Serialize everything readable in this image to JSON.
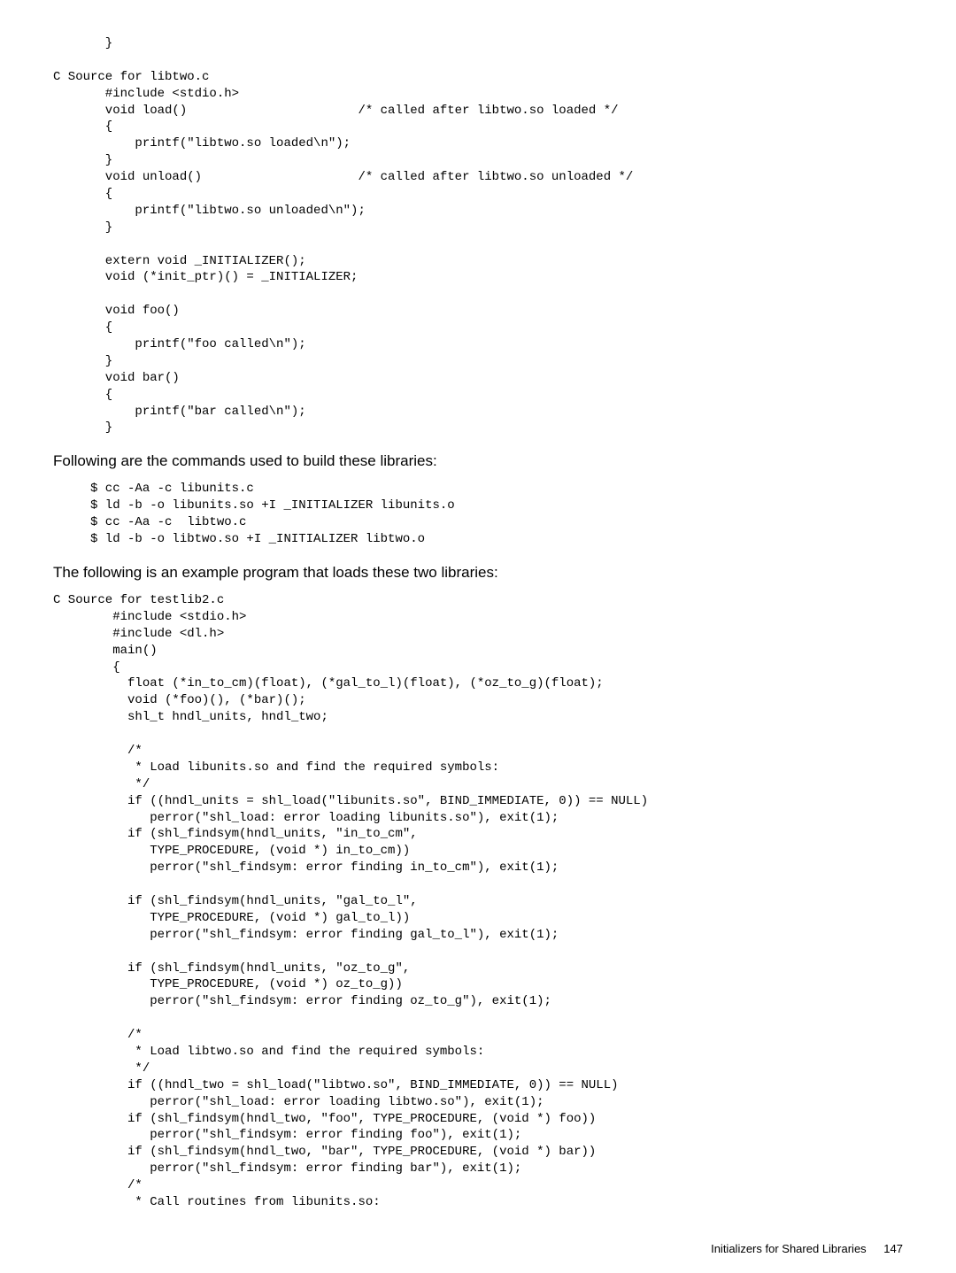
{
  "block1": "       }\n\nC Source for libtwo.c\n       #include <stdio.h>\n       void load()                       /* called after libtwo.so loaded */\n       {\n           printf(\"libtwo.so loaded\\n\");\n       }\n       void unload()                     /* called after libtwo.so unloaded */\n       {\n           printf(\"libtwo.so unloaded\\n\");\n       }\n\n       extern void _INITIALIZER();\n       void (*init_ptr)() = _INITIALIZER;\n\n       void foo()\n       {\n           printf(\"foo called\\n\");\n       }\n       void bar()\n       {\n           printf(\"bar called\\n\");\n       }",
  "narr1": "Following are the commands used to build these libraries:",
  "block2": "     $ cc -Aa -c libunits.c\n     $ ld -b -o libunits.so +I _INITIALIZER libunits.o\n     $ cc -Aa -c  libtwo.c\n     $ ld -b -o libtwo.so +I _INITIALIZER libtwo.o",
  "narr2": "The following is an example program that loads these two libraries:",
  "block3": "C Source for testlib2.c\n        #include <stdio.h>\n        #include <dl.h>\n        main()\n        {\n          float (*in_to_cm)(float), (*gal_to_l)(float), (*oz_to_g)(float);\n          void (*foo)(), (*bar)();\n          shl_t hndl_units, hndl_two;\n\n          /*\n           * Load libunits.so and find the required symbols:\n           */\n          if ((hndl_units = shl_load(\"libunits.so\", BIND_IMMEDIATE, 0)) == NULL)\n             perror(\"shl_load: error loading libunits.so\"), exit(1);\n          if (shl_findsym(hndl_units, \"in_to_cm\",\n             TYPE_PROCEDURE, (void *) in_to_cm))\n             perror(\"shl_findsym: error finding in_to_cm\"), exit(1);\n\n          if (shl_findsym(hndl_units, \"gal_to_l\",\n             TYPE_PROCEDURE, (void *) gal_to_l))\n             perror(\"shl_findsym: error finding gal_to_l\"), exit(1);\n\n          if (shl_findsym(hndl_units, \"oz_to_g\",\n             TYPE_PROCEDURE, (void *) oz_to_g))\n             perror(\"shl_findsym: error finding oz_to_g\"), exit(1);\n\n          /*\n           * Load libtwo.so and find the required symbols:\n           */\n          if ((hndl_two = shl_load(\"libtwo.so\", BIND_IMMEDIATE, 0)) == NULL)\n             perror(\"shl_load: error loading libtwo.so\"), exit(1);\n          if (shl_findsym(hndl_two, \"foo\", TYPE_PROCEDURE, (void *) foo))\n             perror(\"shl_findsym: error finding foo\"), exit(1);\n          if (shl_findsym(hndl_two, \"bar\", TYPE_PROCEDURE, (void *) bar))\n             perror(\"shl_findsym: error finding bar\"), exit(1);\n          /*\n           * Call routines from libunits.so:",
  "footer_label": "Initializers for Shared Libraries",
  "footer_page": "147"
}
